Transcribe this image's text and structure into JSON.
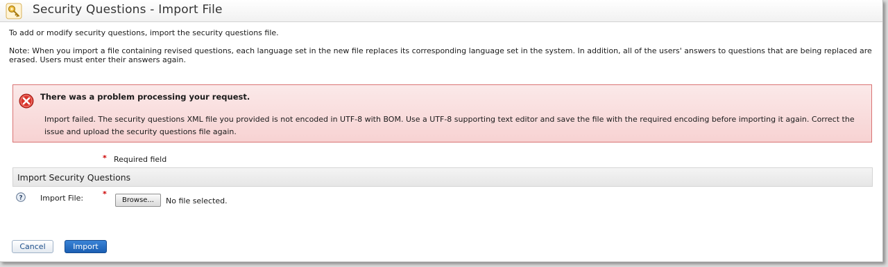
{
  "page": {
    "title": "Security Questions - Import File",
    "title_icon": "key-icon"
  },
  "intro": {
    "text": "To add or modify security questions, import the security questions file.",
    "note": "Note: When you import a file containing revised questions, each language set in the new file replaces its corresponding language set in the system. In addition, all of the users' answers to questions that are being replaced are erased. Users must enter their answers again."
  },
  "error": {
    "icon": "error-x-icon",
    "title": "There was a problem processing your request.",
    "message": "Import failed. The security questions XML file you provided is not encoded in UTF-8 with BOM. Use a UTF-8 supporting text editor and save the file with the required encoding before importing it again. Correct the issue and upload the security questions file again.",
    "border_color": "#d97373",
    "background_color": "#f7d2d2"
  },
  "form": {
    "required_marker": "*",
    "required_label": "Required field",
    "section_title": "Import Security Questions",
    "import_file_label": "Import File:",
    "help_icon": "help-question-icon",
    "browse_label": "Browse...",
    "file_status": "No file selected."
  },
  "actions": {
    "cancel_label": "Cancel",
    "import_label": "Import",
    "primary_color": "#1b5fb3"
  }
}
